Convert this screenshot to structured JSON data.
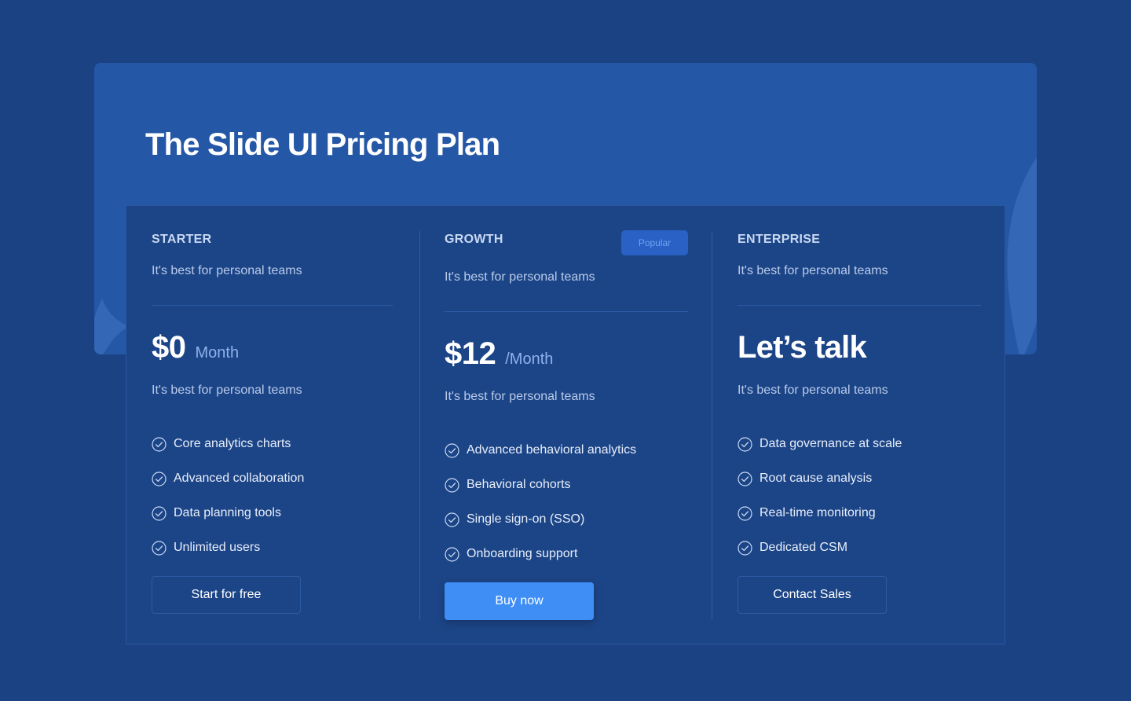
{
  "hero": {
    "title": "The Slide UI Pricing Plan"
  },
  "plans": [
    {
      "name": "STARTER",
      "description": "It's best for personal teams",
      "price": "$0",
      "period": "Month",
      "price_description": "It's best for personal teams",
      "features": [
        "Core analytics charts",
        "Advanced collaboration",
        "Data planning tools",
        "Unlimited users"
      ],
      "cta": "Start for free"
    },
    {
      "name": "GROWTH",
      "badge": "Popular",
      "description": "It's best for personal teams",
      "price": "$12",
      "period": "/Month",
      "price_description": "It's best for personal teams",
      "features": [
        "Advanced behavioral analytics",
        "Behavioral cohorts",
        "Single sign-on (SSO)",
        "Onboarding support"
      ],
      "cta": "Buy now"
    },
    {
      "name": "ENTERPRISE",
      "description": "It's best for personal teams",
      "price": "Let’s talk",
      "price_description": "It's best for personal teams",
      "features": [
        "Data governance at scale",
        "Root cause analysis",
        "Real-time monitoring",
        "Dedicated CSM"
      ],
      "cta": "Contact Sales"
    }
  ],
  "icons": {
    "feature": "check-circle-icon"
  },
  "colors": {
    "background": "#1b4283",
    "hero": "#2457a6",
    "accent": "#3f8ef5",
    "badge_bg": "#2961c4",
    "badge_text": "#6ea3f4"
  }
}
